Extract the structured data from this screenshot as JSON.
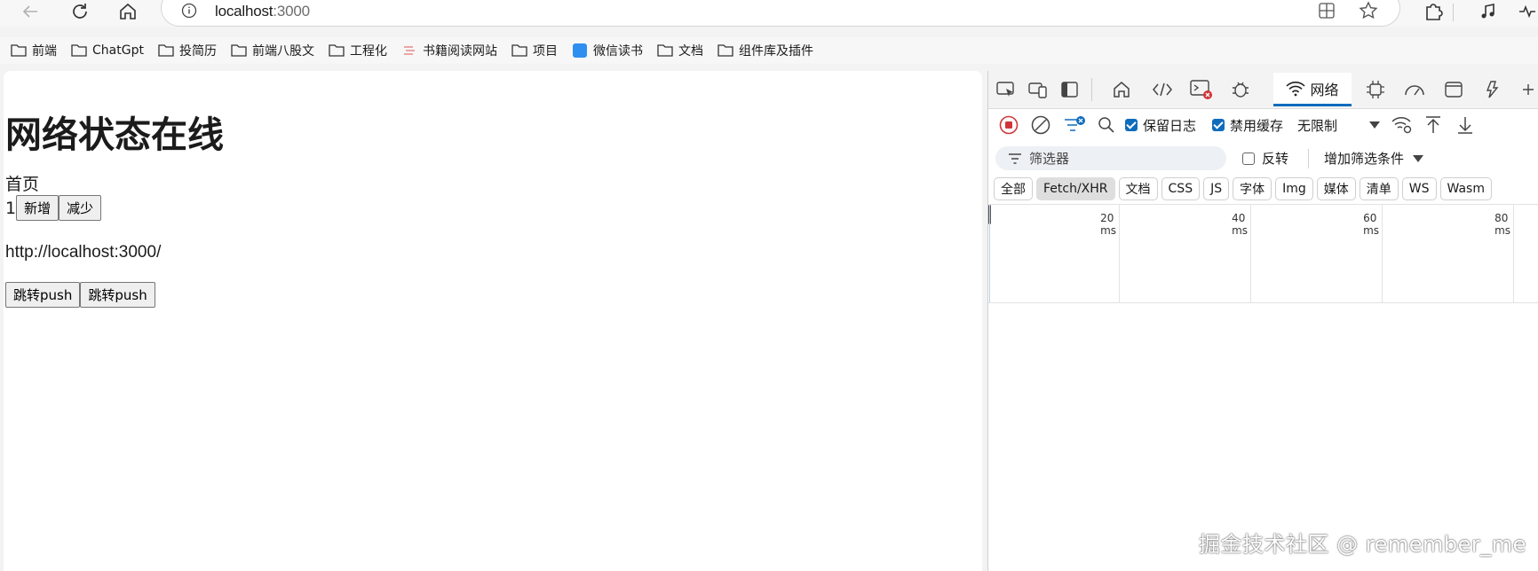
{
  "browser": {
    "address": {
      "host": "localhost",
      "port": ":3000"
    },
    "bookmarks": [
      "前端",
      "ChatGpt",
      "投简历",
      "前端八股文",
      "工程化",
      "书籍阅读网站",
      "项目",
      "微信读书",
      "文档",
      "组件库及插件"
    ]
  },
  "page": {
    "heading": "网络状态在线",
    "nav_link": "首页",
    "counter_value": "1",
    "add_button": "新增",
    "reduce_button": "减少",
    "current_url": "http://localhost:3000/",
    "push_button_1": "跳转push",
    "push_button_2": "跳转push"
  },
  "devtools": {
    "active_tab": "网络",
    "preserve_log": {
      "label": "保留日志",
      "checked": true
    },
    "disable_cache": {
      "label": "禁用缓存",
      "checked": true
    },
    "throttle": "无限制",
    "filter_placeholder": "筛选器",
    "invert": {
      "label": "反转",
      "checked": false
    },
    "more_filters": "增加筛选条件",
    "type_filters": [
      "全部",
      "Fetch/XHR",
      "文档",
      "CSS",
      "JS",
      "字体",
      "Img",
      "媒体",
      "清单",
      "WS",
      "Wasm"
    ],
    "active_type_filter": "Fetch/XHR",
    "timeline_ticks": [
      "20 ms",
      "40 ms",
      "60 ms",
      "80 ms"
    ]
  },
  "watermark": "掘金技术社区 @ remember_me",
  "colors": {
    "accent": "#0f6cbd",
    "record_red": "#d13438"
  }
}
